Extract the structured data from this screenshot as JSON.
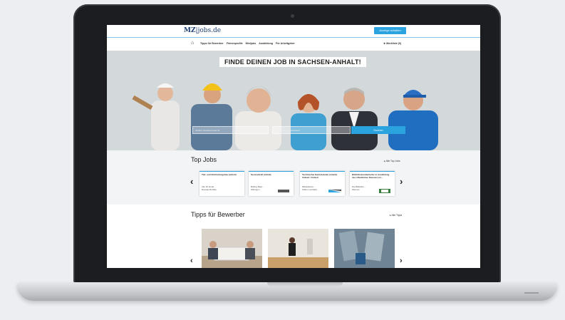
{
  "site": {
    "logo_prefix": "MZ",
    "logo_suffix": "jobs.de",
    "cta_label": "Anzeige schalten"
  },
  "nav": {
    "items": [
      "Tipps für Bewerber",
      "Firmenprofile",
      "Minijobs",
      "Ausbildung",
      "Für Arbeitgeber"
    ],
    "merkliste": "Merkliste (0)"
  },
  "hero": {
    "title": "FINDE DEINEN JOB IN SACHSEN-ANHALT!",
    "search_placeholder": "Jobtitel, Suchwort oder ID",
    "location_placeholder": "Ort, PLZ oder Bundesland",
    "search_button": "Suchen"
  },
  "top_jobs": {
    "heading": "Top Jobs",
    "all_link": "Alle Top Jobs",
    "cards": [
      {
        "title": "Tief- und Rohrleitungsbau (w/m/d)",
        "company": "Info für Ende...",
        "location": "Dessau-Roßlau"
      },
      {
        "title": "Servicekraft (m/w/d)",
        "company": "Bulling Bast...",
        "location": "Wittingen"
      },
      {
        "title": "Technischer Betriebsleiter (m/w/d) Vollzeit / Teilzeit",
        "company": "Mitteldeutsc...",
        "location": "Köthen (Anhalt)"
      },
      {
        "title": "Bibliotheksmitarbeiter in Ausbildung des öffentlichen Dienstes (m...",
        "company": "Die Bibliothe...",
        "location": "Wernau"
      }
    ]
  },
  "tips": {
    "heading": "Tipps für Bewerber",
    "all_link": "Alle Tipps"
  },
  "colors": {
    "accent": "#2ba3df",
    "brand": "#1f3f73"
  }
}
